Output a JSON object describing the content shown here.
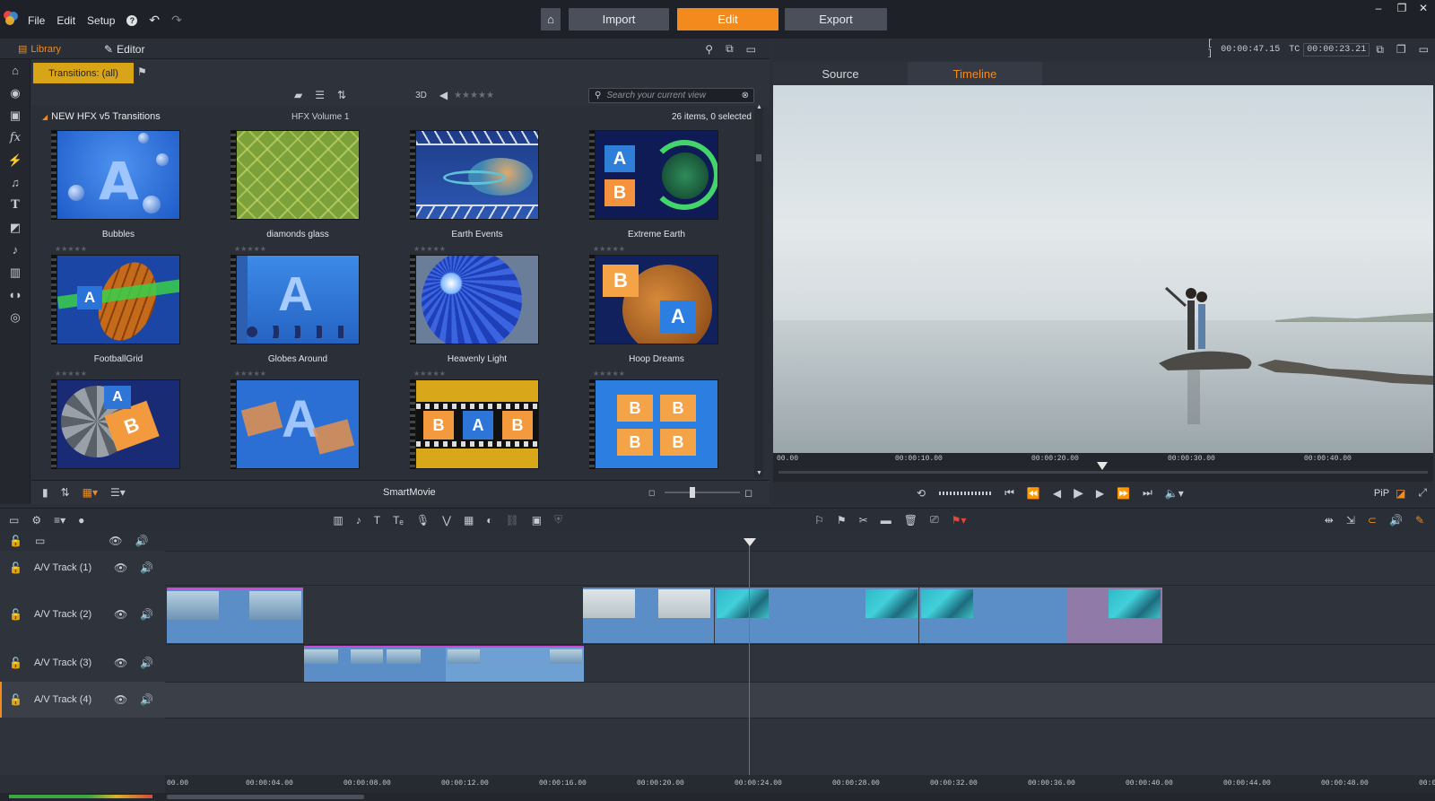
{
  "menu": [
    "File",
    "Edit",
    "Setup"
  ],
  "modes": {
    "import": "Import",
    "edit": "Edit",
    "export": "Export"
  },
  "library": {
    "tab_library": "Library",
    "tab_editor": "Editor",
    "filter": "Transitions: (all)",
    "toolbar_3d": "3D",
    "search_placeholder": "Search your current view",
    "group_name": "NEW HFX v5 Transitions",
    "volume": "HFX Volume 1",
    "count": "26 items, 0 selected",
    "items": [
      {
        "name": "Bubbles"
      },
      {
        "name": "diamonds glass"
      },
      {
        "name": "Earth Events"
      },
      {
        "name": "Extreme Earth"
      },
      {
        "name": "FootballGrid"
      },
      {
        "name": "Globes Around"
      },
      {
        "name": "Heavenly Light"
      },
      {
        "name": "Hoop Dreams"
      },
      {
        "name": ""
      },
      {
        "name": ""
      },
      {
        "name": ""
      },
      {
        "name": ""
      }
    ],
    "bottom_label": "SmartMovie"
  },
  "preview": {
    "duration": "00:00:47.15",
    "tc_label": "TC",
    "timecode": "00:00:23.21",
    "tab_source": "Source",
    "tab_timeline": "Timeline",
    "ruler": [
      "00.00",
      "00:00:10.00",
      "00:00:20.00",
      "00:00:30.00",
      "00:00:40.00"
    ],
    "pip": "PiP"
  },
  "timeline": {
    "tracks": [
      "A/V Track (1)",
      "A/V Track (2)",
      "A/V Track (3)",
      "A/V Track (4)"
    ],
    "ruler": [
      "00.00",
      "00:00:04.00",
      "00:00:08.00",
      "00:00:12.00",
      "00:00:16.00",
      "00:00:20.00",
      "00:00:24.00",
      "00:00:28.00",
      "00:00:32.00",
      "00:00:36.00",
      "00:00:40.00",
      "00:00:44.00",
      "00:00:48.00",
      "00:0"
    ]
  },
  "colors": {
    "accent": "#f28a1e",
    "filter_chip": "#d8a418",
    "clip": "#5b8ec7",
    "playhead": "#e0483a"
  }
}
